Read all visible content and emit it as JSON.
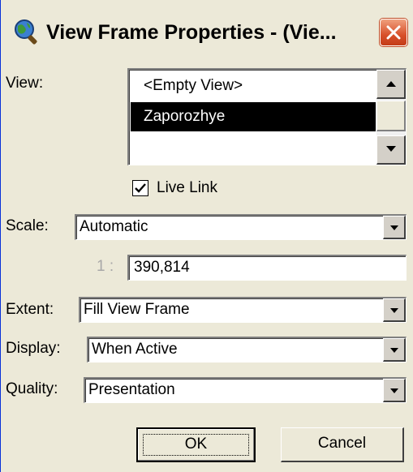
{
  "window": {
    "title": "View Frame Properties - (Vie...",
    "app_icon": "globe-magnifier-icon",
    "close_icon": "close-icon"
  },
  "view": {
    "label": "View:",
    "items": [
      "<Empty View>",
      "Zaporozhye",
      ""
    ],
    "selected": "Zaporozhye"
  },
  "live_link": {
    "label": "Live Link",
    "checked": true
  },
  "scale": {
    "label": "Scale:",
    "value": "Automatic",
    "ratio_prefix": "1 :",
    "ratio_value": "390,814"
  },
  "extent": {
    "label": "Extent:",
    "value": "Fill View Frame"
  },
  "display": {
    "label": "Display:",
    "value": "When Active"
  },
  "quality": {
    "label": "Quality:",
    "value": "Presentation"
  },
  "buttons": {
    "ok": "OK",
    "cancel": "Cancel"
  },
  "colors": {
    "dialog_bg": "#ece9d8",
    "selection_bg": "#000000",
    "close_red": "#d8502a"
  }
}
